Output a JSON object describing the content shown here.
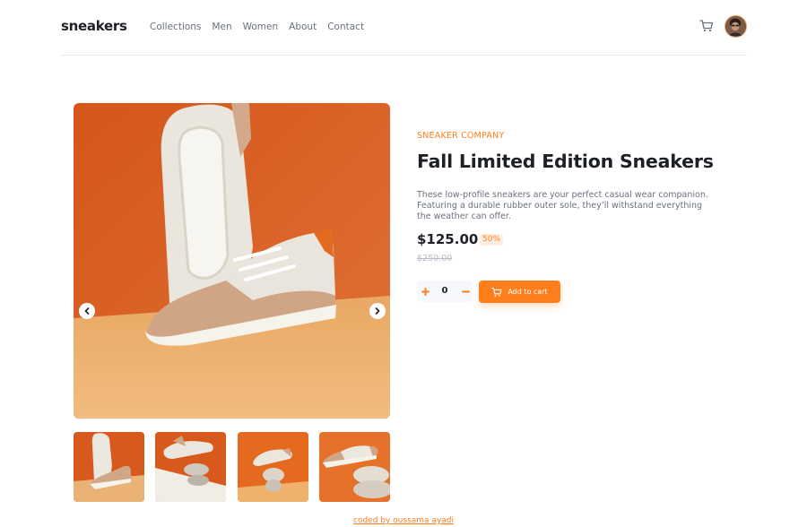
{
  "header": {
    "logo": "sneakers",
    "nav": [
      "Collections",
      "Men",
      "Women",
      "About",
      "Contact"
    ]
  },
  "product": {
    "company": "SNEAKER COMPANY",
    "title": "Fall Limited Edition Sneakers",
    "description": "These low-profile sneakers are your perfect casual wear companion. Featuring a durable rubber outer sole, they’ll withstand everything the weather can offer.",
    "price": "$125.00",
    "discount": "50%",
    "old_price": "$250.00"
  },
  "cart": {
    "quantity": "0",
    "add_label": "Add to cart"
  },
  "footer": {
    "credit": "coded by oussama ayadi"
  },
  "colors": {
    "accent": "#ff7e1b",
    "accent_pale": "#ffede0",
    "text_dark": "#1d2025",
    "text_gray": "#69707d"
  },
  "icons": {
    "cart": "cart-icon",
    "prev": "chevron-left-icon",
    "next": "chevron-right-icon",
    "plus": "plus-icon",
    "minus": "minus-icon"
  }
}
